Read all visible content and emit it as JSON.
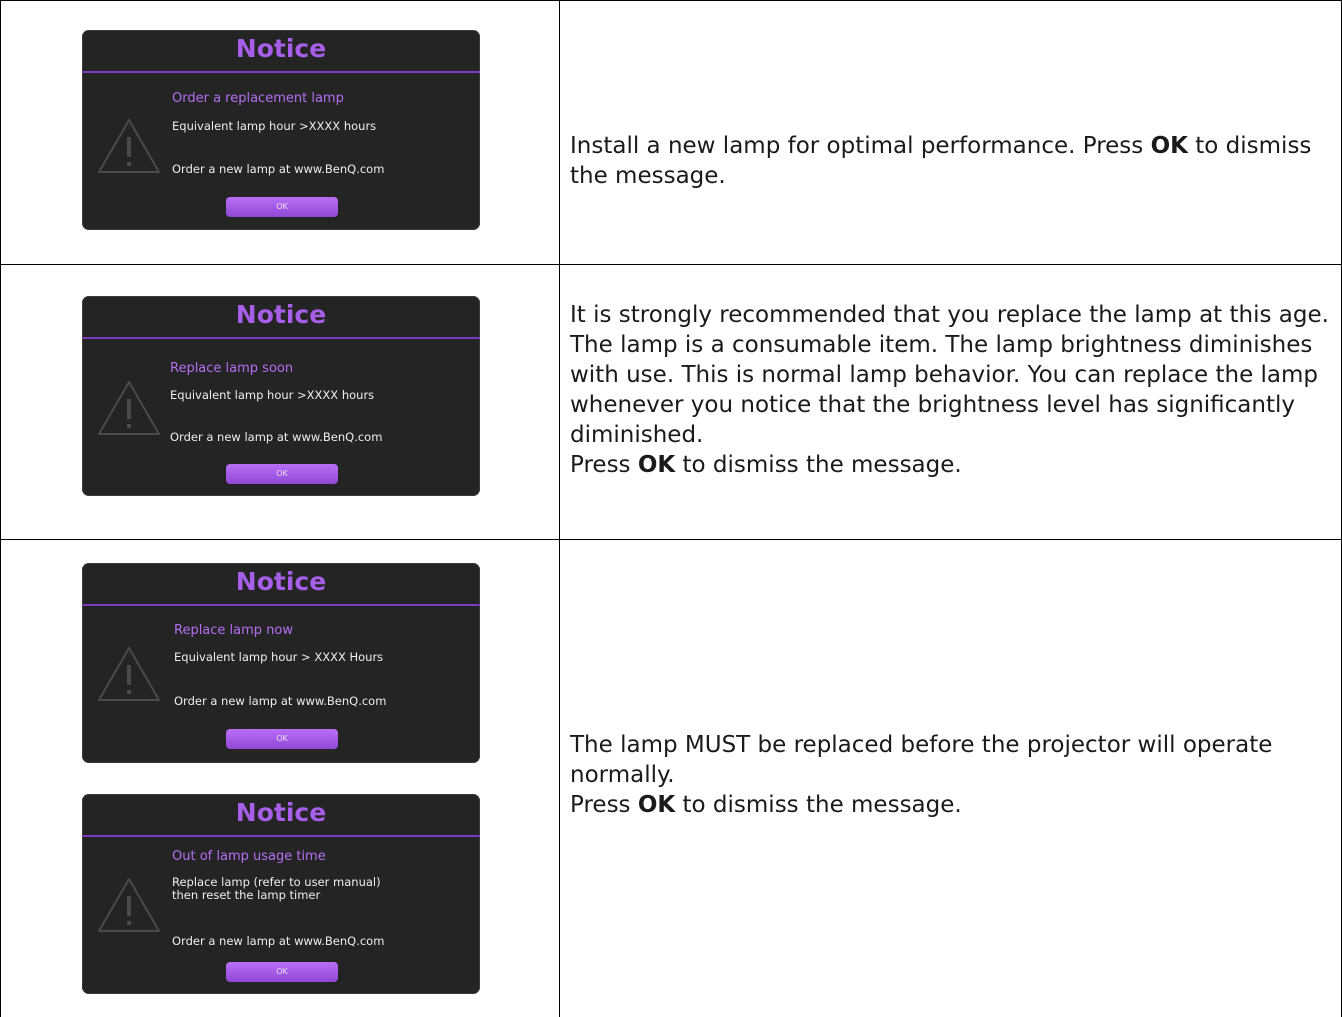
{
  "rows": [
    {
      "notices": [
        {
          "title": "Notice",
          "subtitle": "Order a replacement lamp",
          "line1": "Equivalent lamp hour >XXXX hours",
          "line2": "Order a new lamp at www.BenQ.com",
          "button": "OK"
        }
      ],
      "desc": {
        "p1_before": "Install a new lamp for optimal performance. Press ",
        "p1_ok": "OK",
        "p1_after": " to dismiss the message."
      }
    },
    {
      "notices": [
        {
          "title": "Notice",
          "subtitle": "Replace lamp soon",
          "line1": "Equivalent lamp hour >XXXX hours",
          "line2": "Order a new lamp at www.BenQ.com",
          "button": "OK"
        }
      ],
      "desc": {
        "p1": "It is strongly recommended that you replace the lamp at this age. The lamp is a consumable item. The lamp brightness diminishes with use. This is normal lamp behavior. You can replace the lamp whenever you notice that the brightness level has significantly diminished.",
        "p2_before": "Press ",
        "p2_ok": "OK",
        "p2_after": " to dismiss the message."
      }
    },
    {
      "notices": [
        {
          "title": "Notice",
          "subtitle": "Replace lamp now",
          "line1": "Equivalent lamp hour > XXXX Hours",
          "line2": "Order a new lamp at www.BenQ.com",
          "button": "OK"
        },
        {
          "title": "Notice",
          "subtitle": "Out of lamp usage time",
          "line1": "Replace lamp (refer to user manual)",
          "line1b": "then reset the lamp timer",
          "line2": "Order a new lamp at www.BenQ.com",
          "button": "OK"
        }
      ],
      "desc": {
        "p1": "The lamp MUST be replaced before the projector will operate normally.",
        "p2_before": "Press ",
        "p2_ok": "OK",
        "p2_after": " to dismiss the message."
      }
    }
  ],
  "colors": {
    "dialog_bg": "#242424",
    "accent": "#a75ee8",
    "button": "#a35ee8"
  }
}
